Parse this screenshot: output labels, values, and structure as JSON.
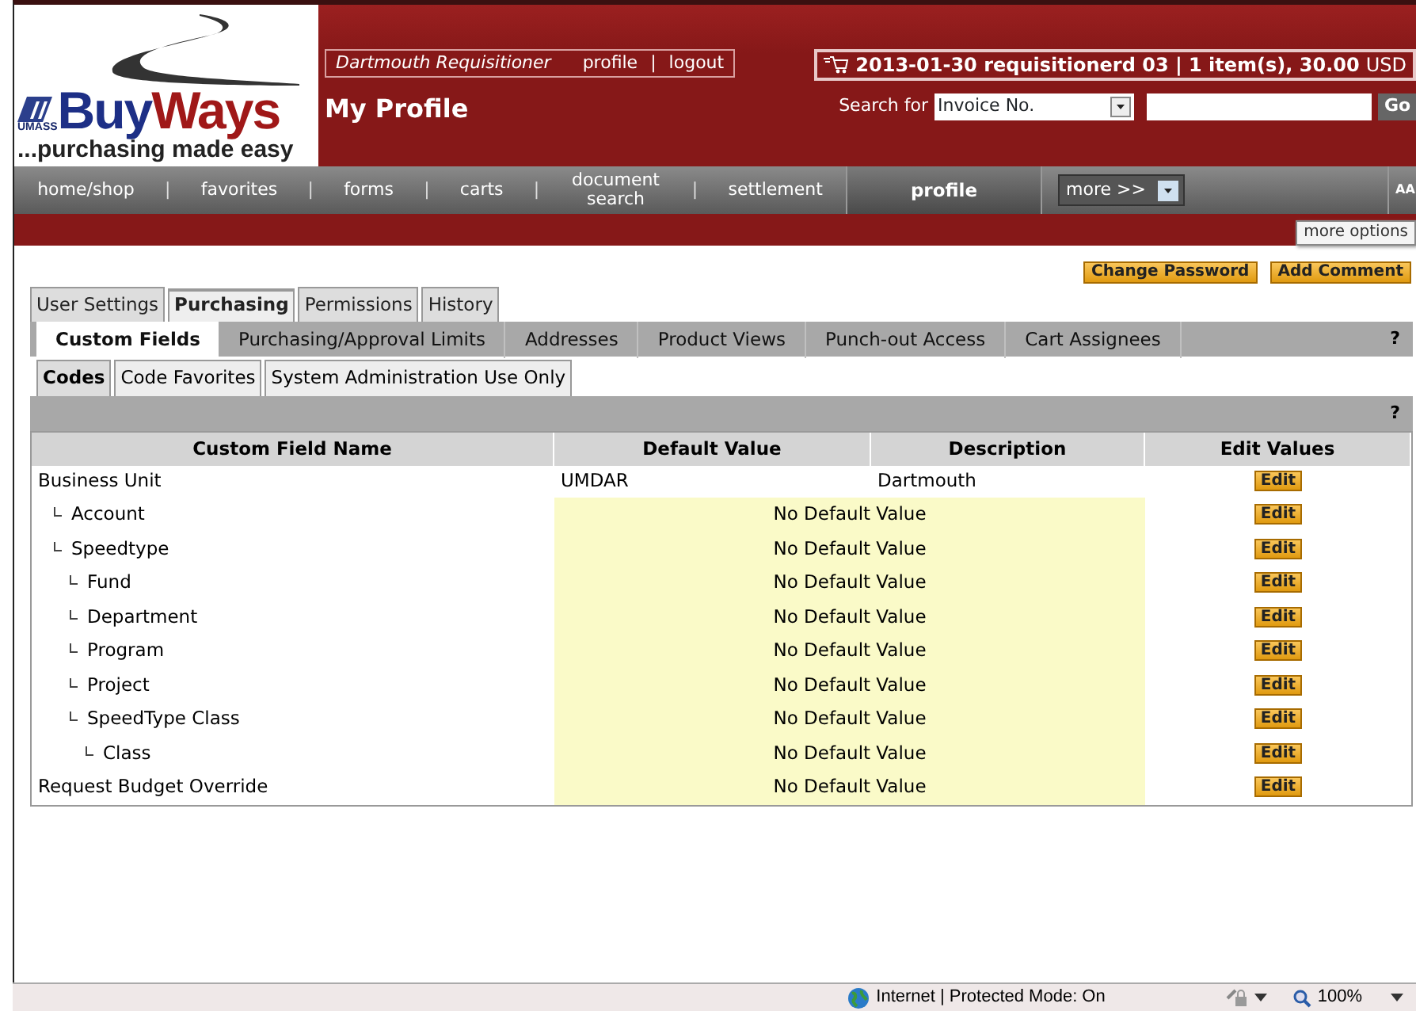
{
  "logo": {
    "badge": "UMASS",
    "word_1": "Buy",
    "word_2": "Ways",
    "tagline": "...purchasing made easy"
  },
  "user_bar": {
    "user": "Dartmouth Requisitioner",
    "links": [
      "profile",
      "logout"
    ],
    "separators": [
      "|"
    ]
  },
  "page_title": "My Profile",
  "cart": {
    "summary": "2013-01-30 requisitionerd 03 | 1 item(s), 30.00",
    "currency": "USD"
  },
  "search": {
    "label": "Search for",
    "type": "Invoice No.",
    "button": "Go"
  },
  "nav": [
    {
      "label": "home/shop",
      "selected": false
    },
    {
      "label": "favorites",
      "selected": false
    },
    {
      "label": "forms",
      "selected": false
    },
    {
      "label": "carts",
      "selected": false
    },
    {
      "label": "document search",
      "selected": false
    },
    {
      "label": "settlement",
      "selected": false
    },
    {
      "label": "profile",
      "selected": true
    }
  ],
  "nav_separators": [
    "|",
    "|",
    "|",
    "|",
    "|"
  ],
  "more_menu": "more >>",
  "text_size": "AA",
  "tooltip": "more options",
  "actions": [
    "Change Password",
    "Add Comment"
  ],
  "tabs": [
    {
      "label": "User Settings",
      "selected": false
    },
    {
      "label": "Purchasing",
      "selected": true
    },
    {
      "label": "Permissions",
      "selected": false
    },
    {
      "label": "History",
      "selected": false
    }
  ],
  "subtabs": [
    {
      "label": "Custom Fields",
      "selected": true
    },
    {
      "label": "Purchasing/Approval Limits",
      "selected": false
    },
    {
      "label": "Addresses",
      "selected": false
    },
    {
      "label": "Product Views",
      "selected": false
    },
    {
      "label": "Punch-out Access",
      "selected": false
    },
    {
      "label": "Cart Assignees",
      "selected": false
    }
  ],
  "subtabs_help": "?",
  "code_tabs": [
    {
      "label": "Codes",
      "selected": true
    },
    {
      "label": "Code Favorites",
      "selected": false
    },
    {
      "label": "System Administration Use Only",
      "selected": false
    }
  ],
  "code_help": "?",
  "table": {
    "columns": [
      "Custom Field Name",
      "Default Value",
      "Description",
      "Edit Values"
    ],
    "rows": [
      {
        "name": "Business Unit",
        "kind": "set",
        "default_value": "UMDAR",
        "description": "Dartmouth",
        "edit": "Edit",
        "children": [
          {
            "name": "Account",
            "kind": "unset",
            "default_value": "No Default Value",
            "edit": "Edit"
          },
          {
            "name": "Speedtype",
            "kind": "unset",
            "default_value": "No Default Value",
            "edit": "Edit",
            "children": [
              {
                "name": "Fund",
                "kind": "unset",
                "default_value": "No Default Value",
                "edit": "Edit"
              },
              {
                "name": "Department",
                "kind": "unset",
                "default_value": "No Default Value",
                "edit": "Edit"
              },
              {
                "name": "Program",
                "kind": "unset",
                "default_value": "No Default Value",
                "edit": "Edit"
              },
              {
                "name": "Project",
                "kind": "unset",
                "default_value": "No Default Value",
                "edit": "Edit"
              },
              {
                "name": "SpeedType Class",
                "kind": "unset",
                "default_value": "No Default Value",
                "edit": "Edit",
                "children": [
                  {
                    "name": "Class",
                    "kind": "unset",
                    "default_value": "No Default Value",
                    "edit": "Edit"
                  }
                ]
              }
            ]
          }
        ]
      },
      {
        "name": "Request Budget Override",
        "kind": "unset",
        "default_value": "No Default Value",
        "edit": "Edit"
      }
    ]
  },
  "status_bar": {
    "zone": "Internet | Protected Mode: On",
    "zoom": "100%"
  }
}
